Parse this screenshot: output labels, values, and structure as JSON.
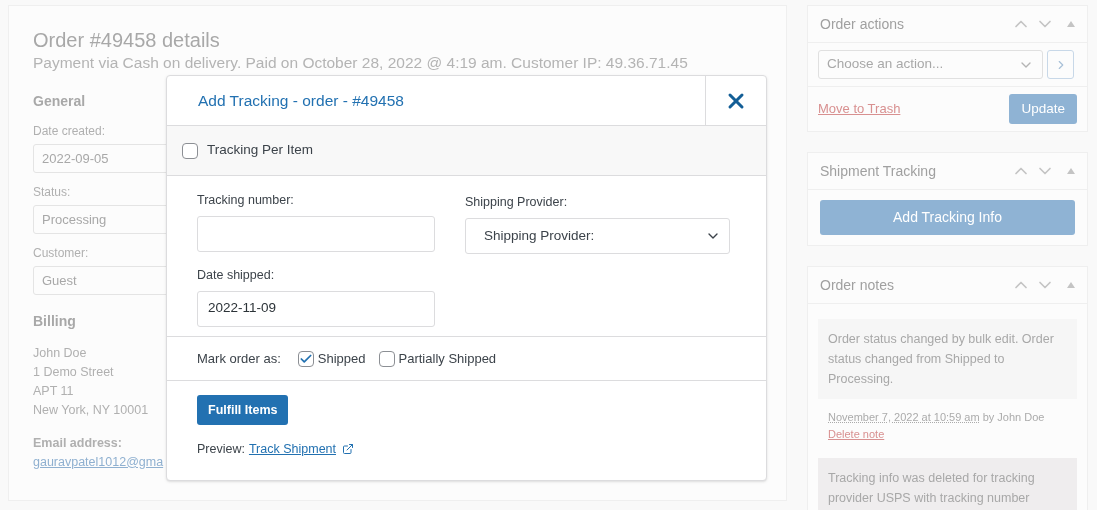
{
  "order": {
    "title": "Order #49458 details",
    "subtitle": "Payment via Cash on delivery. Paid on October 28, 2022 @ 4:19 am. Customer IP: 49.36.71.45",
    "general": {
      "heading": "General",
      "fields": [
        {
          "label": "Date created:",
          "value": "2022-09-05"
        },
        {
          "label": "Status:",
          "value": "Processing"
        },
        {
          "label": "Customer:",
          "value": "Guest"
        }
      ]
    },
    "billing": {
      "heading": "Billing",
      "lines": [
        "John Doe",
        "1 Demo Street",
        "APT 11",
        "New York, NY 10001"
      ]
    },
    "email": {
      "label": "Email address:",
      "value": "gauravpatel1012@gma"
    }
  },
  "order_actions": {
    "title": "Order actions",
    "select": {
      "value": "Choose an action..."
    },
    "trash_link": "Move to Trash",
    "update_button": "Update"
  },
  "shipment_tracking": {
    "title": "Shipment Tracking",
    "button": "Add Tracking Info"
  },
  "order_notes": {
    "title": "Order notes",
    "notes": [
      {
        "kind": "private",
        "text": "Order status changed by bulk edit. Order status changed from Shipped to Processing.",
        "date": "November 7, 2022 at 10:59 am",
        "author": "by John Doe",
        "delete": "Delete note"
      },
      {
        "kind": "system",
        "text": "Tracking info was deleted for tracking provider USPS with tracking number"
      }
    ]
  },
  "modal": {
    "title": "Add Tracking - order - #49458",
    "per_item": {
      "label": "Tracking Per Item",
      "checked": false
    },
    "tracking_number": {
      "label": "Tracking number:"
    },
    "provider": {
      "label": "Shipping Provider:",
      "value": "Shipping Provider:"
    },
    "date_shipped": {
      "label": "Date shipped:",
      "value": "2022-11-09"
    },
    "mark_label": "Mark order as:",
    "mark_options": [
      {
        "label": "Shipped",
        "checked": true
      },
      {
        "label": "Partially Shipped",
        "checked": false
      }
    ],
    "submit": "Fulfill Items",
    "preview_label": "Preview:",
    "preview_link": "Track Shipment"
  }
}
